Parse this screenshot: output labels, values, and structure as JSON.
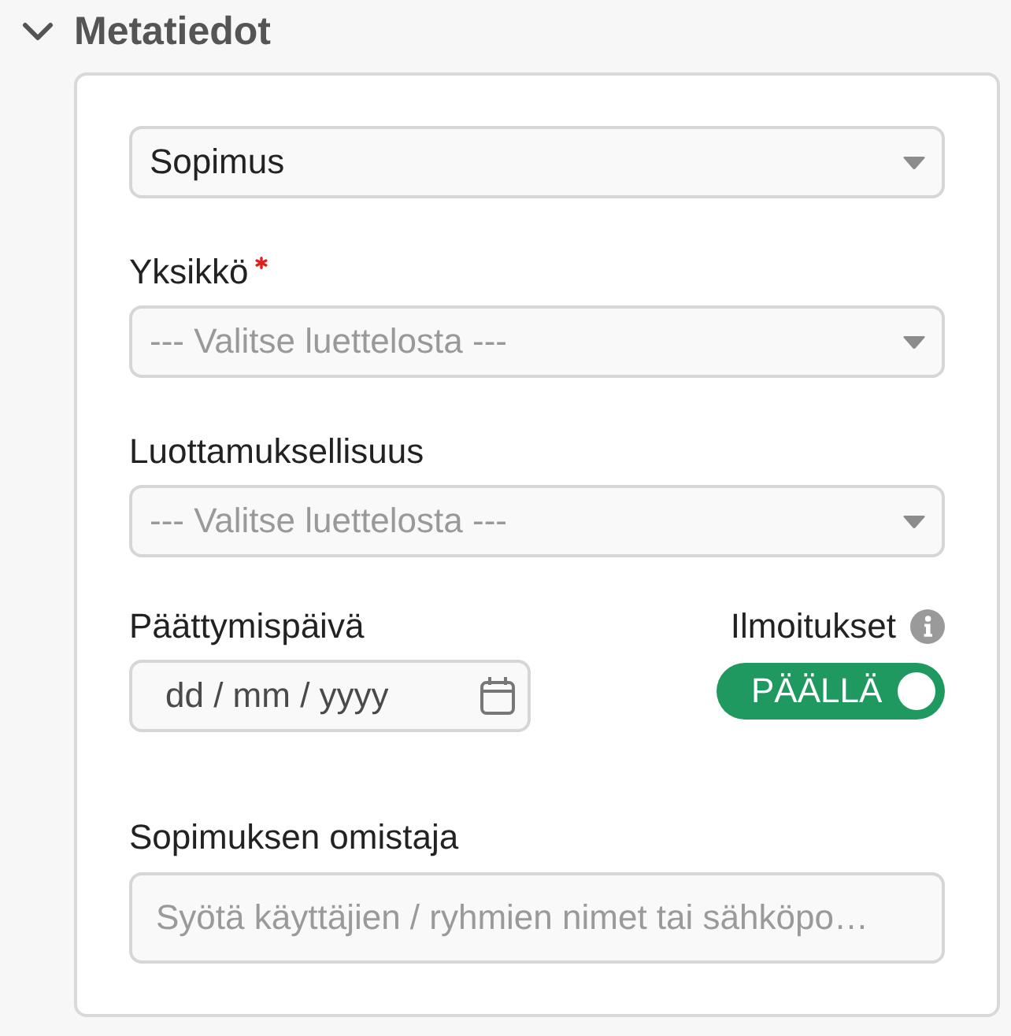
{
  "section": {
    "title": "Metatiedot",
    "expanded": true
  },
  "type_select": {
    "value": "Sopimus"
  },
  "fields": [
    {
      "label": "Yksikkö",
      "required": true,
      "placeholder": "--- Valitse luettelosta ---"
    },
    {
      "label": "Luottamuksellisuus",
      "required": false,
      "placeholder": "--- Valitse luettelosta ---"
    }
  ],
  "end_date": {
    "label": "Päättymispäivä",
    "placeholder": "dd / mm / yyyy"
  },
  "notifications": {
    "label": "Ilmoitukset",
    "on": true,
    "state_text": "PÄÄLLÄ"
  },
  "owner": {
    "label": "Sopimuksen omistaja",
    "placeholder": "Syötä käyttäjien / ryhmien nimet tai sähköpo…"
  }
}
